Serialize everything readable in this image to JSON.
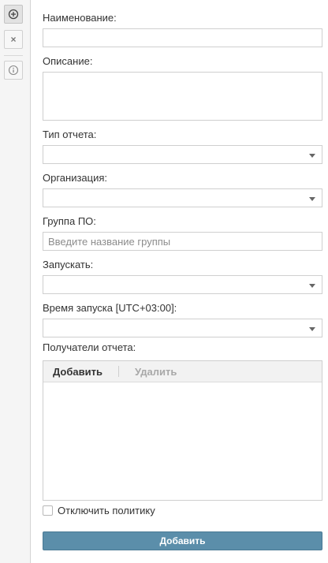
{
  "toolbar": {
    "add_icon": "circle-plus-icon",
    "close_icon": "close-icon",
    "info_icon": "info-icon",
    "close_glyph": "×",
    "add_glyph": "⊕",
    "info_glyph": "i"
  },
  "form": {
    "name_label": "Наименование:",
    "name_value": "",
    "description_label": "Описание:",
    "description_value": "",
    "report_type_label": "Тип отчета:",
    "report_type_value": "",
    "organization_label": "Организация:",
    "organization_value": "",
    "group_label": "Группа ПО:",
    "group_placeholder": "Введите название группы",
    "run_label": "Запускать:",
    "run_value": "",
    "time_label": "Время запуска [UTC+03:00]:",
    "time_value": "",
    "recipients_label": "Получатели отчета:",
    "recipients_add": "Добавить",
    "recipients_delete": "Удалить",
    "recipients": [],
    "disable_policy_label": "Отключить политику",
    "disable_policy_checked": false,
    "submit_label": "Добавить"
  },
  "colors": {
    "primary_button": "#5b8eaa",
    "toolbar_bg": "#f5f5f5",
    "border": "#cfcfcf"
  }
}
